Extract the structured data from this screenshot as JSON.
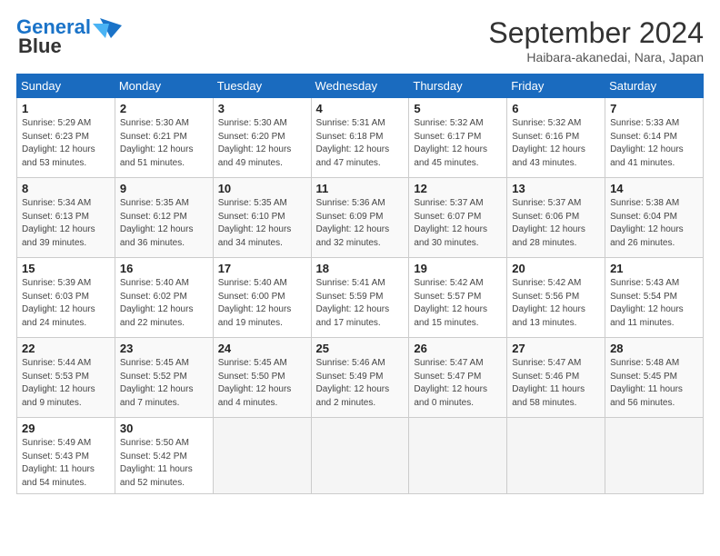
{
  "header": {
    "logo_line1": "General",
    "logo_line2": "Blue",
    "month": "September 2024",
    "location": "Haibara-akanedai, Nara, Japan"
  },
  "weekdays": [
    "Sunday",
    "Monday",
    "Tuesday",
    "Wednesday",
    "Thursday",
    "Friday",
    "Saturday"
  ],
  "weeks": [
    [
      {
        "day": 1,
        "info": "Sunrise: 5:29 AM\nSunset: 6:23 PM\nDaylight: 12 hours\nand 53 minutes."
      },
      {
        "day": 2,
        "info": "Sunrise: 5:30 AM\nSunset: 6:21 PM\nDaylight: 12 hours\nand 51 minutes."
      },
      {
        "day": 3,
        "info": "Sunrise: 5:30 AM\nSunset: 6:20 PM\nDaylight: 12 hours\nand 49 minutes."
      },
      {
        "day": 4,
        "info": "Sunrise: 5:31 AM\nSunset: 6:18 PM\nDaylight: 12 hours\nand 47 minutes."
      },
      {
        "day": 5,
        "info": "Sunrise: 5:32 AM\nSunset: 6:17 PM\nDaylight: 12 hours\nand 45 minutes."
      },
      {
        "day": 6,
        "info": "Sunrise: 5:32 AM\nSunset: 6:16 PM\nDaylight: 12 hours\nand 43 minutes."
      },
      {
        "day": 7,
        "info": "Sunrise: 5:33 AM\nSunset: 6:14 PM\nDaylight: 12 hours\nand 41 minutes."
      }
    ],
    [
      {
        "day": 8,
        "info": "Sunrise: 5:34 AM\nSunset: 6:13 PM\nDaylight: 12 hours\nand 39 minutes."
      },
      {
        "day": 9,
        "info": "Sunrise: 5:35 AM\nSunset: 6:12 PM\nDaylight: 12 hours\nand 36 minutes."
      },
      {
        "day": 10,
        "info": "Sunrise: 5:35 AM\nSunset: 6:10 PM\nDaylight: 12 hours\nand 34 minutes."
      },
      {
        "day": 11,
        "info": "Sunrise: 5:36 AM\nSunset: 6:09 PM\nDaylight: 12 hours\nand 32 minutes."
      },
      {
        "day": 12,
        "info": "Sunrise: 5:37 AM\nSunset: 6:07 PM\nDaylight: 12 hours\nand 30 minutes."
      },
      {
        "day": 13,
        "info": "Sunrise: 5:37 AM\nSunset: 6:06 PM\nDaylight: 12 hours\nand 28 minutes."
      },
      {
        "day": 14,
        "info": "Sunrise: 5:38 AM\nSunset: 6:04 PM\nDaylight: 12 hours\nand 26 minutes."
      }
    ],
    [
      {
        "day": 15,
        "info": "Sunrise: 5:39 AM\nSunset: 6:03 PM\nDaylight: 12 hours\nand 24 minutes."
      },
      {
        "day": 16,
        "info": "Sunrise: 5:40 AM\nSunset: 6:02 PM\nDaylight: 12 hours\nand 22 minutes."
      },
      {
        "day": 17,
        "info": "Sunrise: 5:40 AM\nSunset: 6:00 PM\nDaylight: 12 hours\nand 19 minutes."
      },
      {
        "day": 18,
        "info": "Sunrise: 5:41 AM\nSunset: 5:59 PM\nDaylight: 12 hours\nand 17 minutes."
      },
      {
        "day": 19,
        "info": "Sunrise: 5:42 AM\nSunset: 5:57 PM\nDaylight: 12 hours\nand 15 minutes."
      },
      {
        "day": 20,
        "info": "Sunrise: 5:42 AM\nSunset: 5:56 PM\nDaylight: 12 hours\nand 13 minutes."
      },
      {
        "day": 21,
        "info": "Sunrise: 5:43 AM\nSunset: 5:54 PM\nDaylight: 12 hours\nand 11 minutes."
      }
    ],
    [
      {
        "day": 22,
        "info": "Sunrise: 5:44 AM\nSunset: 5:53 PM\nDaylight: 12 hours\nand 9 minutes."
      },
      {
        "day": 23,
        "info": "Sunrise: 5:45 AM\nSunset: 5:52 PM\nDaylight: 12 hours\nand 7 minutes."
      },
      {
        "day": 24,
        "info": "Sunrise: 5:45 AM\nSunset: 5:50 PM\nDaylight: 12 hours\nand 4 minutes."
      },
      {
        "day": 25,
        "info": "Sunrise: 5:46 AM\nSunset: 5:49 PM\nDaylight: 12 hours\nand 2 minutes."
      },
      {
        "day": 26,
        "info": "Sunrise: 5:47 AM\nSunset: 5:47 PM\nDaylight: 12 hours\nand 0 minutes."
      },
      {
        "day": 27,
        "info": "Sunrise: 5:47 AM\nSunset: 5:46 PM\nDaylight: 11 hours\nand 58 minutes."
      },
      {
        "day": 28,
        "info": "Sunrise: 5:48 AM\nSunset: 5:45 PM\nDaylight: 11 hours\nand 56 minutes."
      }
    ],
    [
      {
        "day": 29,
        "info": "Sunrise: 5:49 AM\nSunset: 5:43 PM\nDaylight: 11 hours\nand 54 minutes."
      },
      {
        "day": 30,
        "info": "Sunrise: 5:50 AM\nSunset: 5:42 PM\nDaylight: 11 hours\nand 52 minutes."
      },
      null,
      null,
      null,
      null,
      null
    ]
  ]
}
